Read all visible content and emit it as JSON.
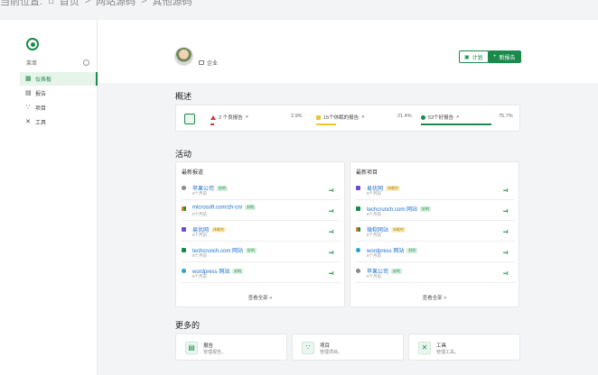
{
  "breadcrumb": {
    "prefix": "当前位置:",
    "home": "首页",
    "sep": ">",
    "section": "网站源码",
    "current": "其他源码"
  },
  "sidebar": {
    "workspace": "菜单",
    "items": [
      {
        "label": "仪表板",
        "icon": "grid-icon",
        "active": true
      },
      {
        "label": "报告",
        "icon": "report-icon",
        "active": false
      },
      {
        "label": "项目",
        "icon": "project-icon",
        "active": false
      },
      {
        "label": "工具",
        "icon": "tools-icon",
        "active": false
      }
    ]
  },
  "header": {
    "org": "企业",
    "plan_button": "计划",
    "new_report_button": "新报告"
  },
  "overview": {
    "title": "概述",
    "items": [
      {
        "label": "2 个良报告",
        "chevron": ">",
        "pct": "2.9%",
        "color": "#d33"
      },
      {
        "label": "15个休眠的报告",
        "chevron": ">",
        "pct": "21.4%",
        "color": "#f2c230"
      },
      {
        "label": "53个好报告",
        "chevron": ">",
        "pct": "75.7%",
        "color": "#1a8a4a"
      }
    ]
  },
  "activity": {
    "title": "活动",
    "recent_reports": {
      "title": "最新报道",
      "see_all": "查看全部 >",
      "rows": [
        {
          "name": "苹果公司",
          "tag": "好的",
          "tag_color": "green",
          "time": "8个月前",
          "icon_color": "#888",
          "status": "•••ll"
        },
        {
          "name": "microsoft.com/zh-cn/",
          "tag": "好的",
          "tag_color": "green",
          "time": "8个月前",
          "icon_color": "#e77b1f",
          "status": "•••ll"
        },
        {
          "name": "易优网",
          "tag": "休眠的",
          "tag_color": "yellow",
          "time": "8个月前",
          "icon_color": "#6f4ad6",
          "status": "•••ll"
        },
        {
          "name": "techcrunch.com 网站",
          "tag": "好的",
          "tag_color": "green",
          "time": "8个月前",
          "icon_color": "#1a8a4a",
          "status": "•••ll"
        },
        {
          "name": "wordpress 网站",
          "tag": "好的",
          "tag_color": "green",
          "time": "8个月前",
          "icon_color": "#2aa4c8",
          "status": "•••ll"
        }
      ]
    },
    "recent_projects": {
      "title": "最新项目",
      "see_all": "查看全部 >",
      "rows": [
        {
          "name": "易优网",
          "tag": "休眠的",
          "tag_color": "yellow",
          "time": "8个月前",
          "icon_color": "#6f4ad6",
          "status": "•••ll"
        },
        {
          "name": "techcrunch.com 网站",
          "tag": "好的",
          "tag_color": "green",
          "time": "8个月前",
          "icon_color": "#1a8a4a",
          "status": "•••ll"
        },
        {
          "name": "微软网站",
          "tag": "休眠的",
          "tag_color": "yellow",
          "time": "8个月前",
          "icon_color": "#e77b1f",
          "status": "•••ll"
        },
        {
          "name": "wordpress 网站",
          "tag": "好的",
          "tag_color": "green",
          "time": "8个月前",
          "icon_color": "#2aa4c8",
          "status": "•••ll"
        },
        {
          "name": "苹果公司",
          "tag": "好的",
          "tag_color": "green",
          "time": "8个月前",
          "icon_color": "#888",
          "status": "•••ll"
        }
      ]
    }
  },
  "more": {
    "title": "更多的",
    "items": [
      {
        "title": "报告",
        "desc": "管理报告。",
        "icon": "report-icon"
      },
      {
        "title": "项目",
        "desc": "管理项目。",
        "icon": "project-icon"
      },
      {
        "title": "工具",
        "desc": "管理工具。",
        "icon": "tools-icon"
      }
    ]
  },
  "colors": {
    "accent": "#1a8a4a",
    "bad": "#d33",
    "idle": "#f2c230"
  }
}
